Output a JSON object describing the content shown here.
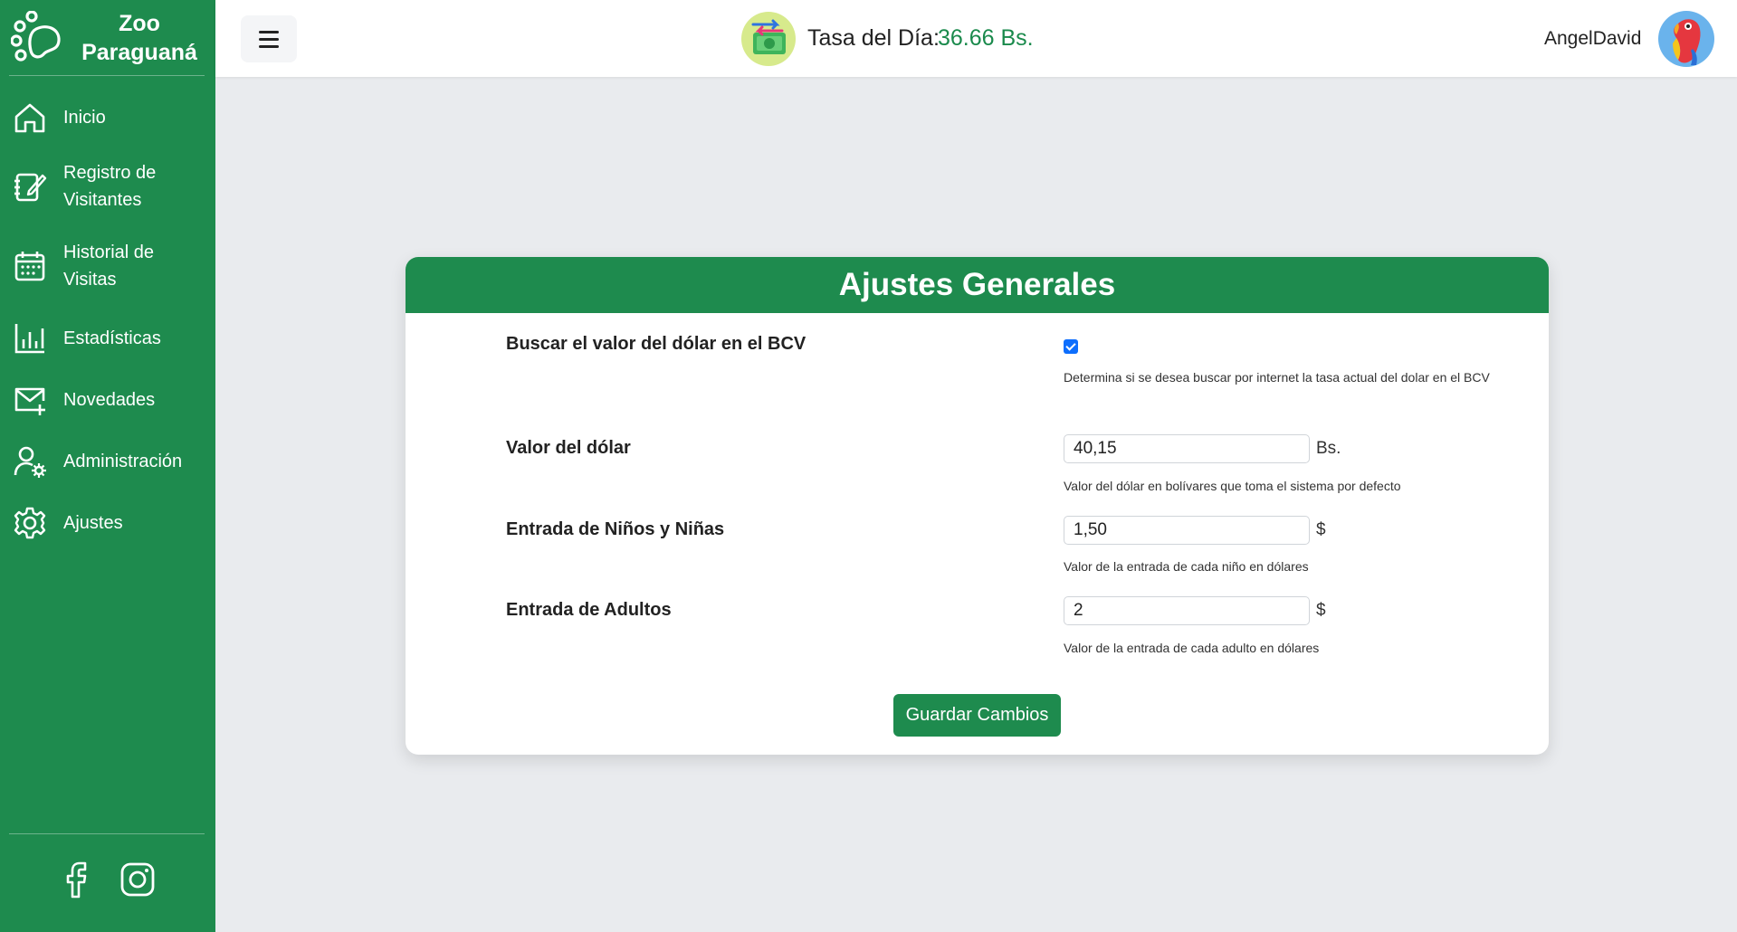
{
  "brand": {
    "name_line1": "Zoo",
    "name_line2": "Paraguaná"
  },
  "nav": {
    "items": [
      {
        "label_line1": "Inicio",
        "label_line2": ""
      },
      {
        "label_line1": "Registro de",
        "label_line2": "Visitantes"
      },
      {
        "label_line1": "Historial de",
        "label_line2": "Visitas"
      },
      {
        "label_line1": "Estadísticas",
        "label_line2": ""
      },
      {
        "label_line1": "Novedades",
        "label_line2": ""
      },
      {
        "label_line1": "Administración",
        "label_line2": ""
      },
      {
        "label_line1": "Ajustes",
        "label_line2": ""
      }
    ]
  },
  "header": {
    "rate_label": "Tasa del Día:",
    "rate_value": "36.66 Bs.",
    "username": "AngelDavid"
  },
  "settings": {
    "title": "Ajustes Generales",
    "bcv": {
      "label": "Buscar el valor del dólar en el BCV",
      "checked": true,
      "help": "Determina si se desea buscar por internet la tasa actual del dolar en el BCV"
    },
    "dollar": {
      "label": "Valor del dólar",
      "value": "40,15",
      "unit": "Bs.",
      "help": "Valor del dólar en bolívares que toma el sistema por defecto"
    },
    "children": {
      "label": "Entrada de Niños y Niñas",
      "value": "1,50",
      "unit": "$",
      "help": "Valor de la entrada de cada niño en dólares"
    },
    "adults": {
      "label": "Entrada de Adultos",
      "value": "2",
      "unit": "$",
      "help": "Valor de la entrada de cada adulto en dólares"
    },
    "save_label": "Guardar Cambios"
  },
  "colors": {
    "primary": "#1e8b4e",
    "rate": "#1a8a4c",
    "background": "#e9ebee"
  }
}
